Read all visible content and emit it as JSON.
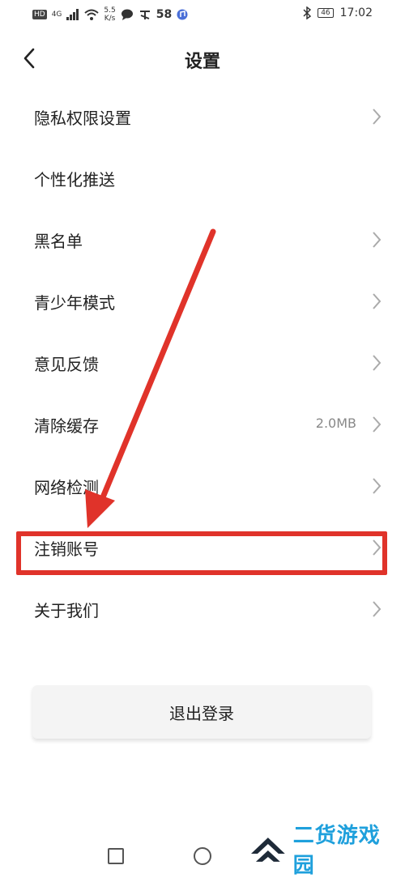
{
  "status_bar": {
    "hd": "HD",
    "net_type": "4G",
    "speed_value": "5.5",
    "speed_unit": "K/s",
    "notif_count": "58",
    "battery": "46",
    "time": "17:02"
  },
  "header": {
    "title": "设置"
  },
  "settings": {
    "items": [
      {
        "label": "隐私权限设置",
        "value": ""
      },
      {
        "label": "个性化推送",
        "value": ""
      },
      {
        "label": "黑名单",
        "value": ""
      },
      {
        "label": "青少年模式",
        "value": ""
      },
      {
        "label": "意见反馈",
        "value": ""
      },
      {
        "label": "清除缓存",
        "value": "2.0MB"
      },
      {
        "label": "网络检测",
        "value": ""
      },
      {
        "label": "注销账号",
        "value": ""
      },
      {
        "label": "关于我们",
        "value": ""
      }
    ]
  },
  "logout": {
    "label": "退出登录"
  },
  "watermark": {
    "text": "二货游戏园"
  },
  "colors": {
    "annotation_red": "#e0332a",
    "watermark_blue": "#1fa0dc"
  }
}
